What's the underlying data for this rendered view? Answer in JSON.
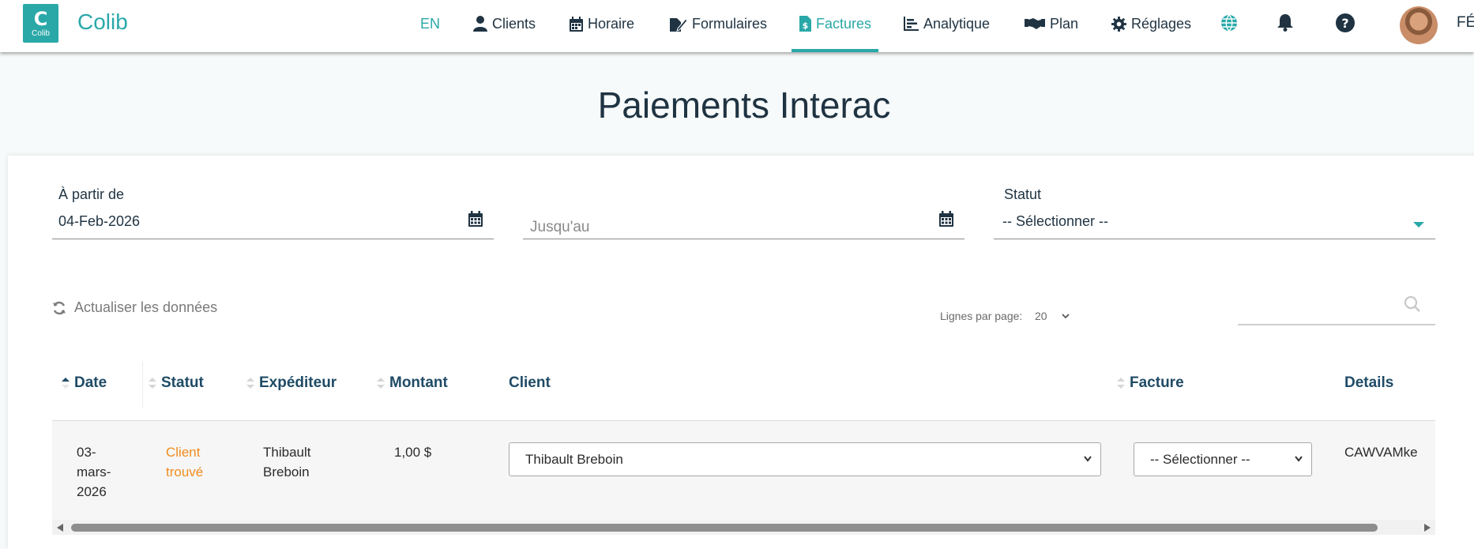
{
  "nav": {
    "logo_letter": "C",
    "logo_small": "Colib",
    "brand": "Colib",
    "lang": "EN",
    "items": [
      {
        "label": "Clients",
        "icon": "user-icon"
      },
      {
        "label": "Horaire",
        "icon": "calendar-icon"
      },
      {
        "label": "Formulaires",
        "icon": "form-edit-icon"
      },
      {
        "label": "Factures",
        "icon": "invoice-dollar-icon",
        "active": true
      },
      {
        "label": "Analytique",
        "icon": "bar-chart-icon"
      },
      {
        "label": "Plan",
        "icon": "handshake-icon"
      },
      {
        "label": "Réglages",
        "icon": "gear-icon"
      }
    ],
    "user_cut": "FÉ",
    "accent": "#2aa8a8"
  },
  "page": {
    "title": "Paiements Interac"
  },
  "filters": {
    "from_label": "À partir de",
    "from_value": "04-Feb-2026",
    "to_placeholder": "Jusqu'au",
    "status_label": "Statut",
    "status_value": "-- Sélectionner --"
  },
  "toolbar": {
    "refresh_label": "Actualiser les données",
    "rows_label": "Lignes par page:",
    "rows_value": "20"
  },
  "table": {
    "columns": [
      "Date",
      "Statut",
      "Expéditeur",
      "Montant",
      "Client",
      "Facture",
      "Details"
    ],
    "rows": [
      {
        "date_1": "03-",
        "date_2": "mars-",
        "date_3": "2026",
        "status_1": "Client",
        "status_2": "trouvé",
        "sender_1": "Thibault",
        "sender_2": "Breboin",
        "amount": "1,00 $",
        "client": "Thibault Breboin",
        "invoice": "-- Sélectionner --",
        "details": "CAWVAMke"
      }
    ]
  },
  "colors": {
    "accent": "#2aa8a8",
    "status_found": "#f08c1e",
    "header_text": "#1f4b66"
  }
}
